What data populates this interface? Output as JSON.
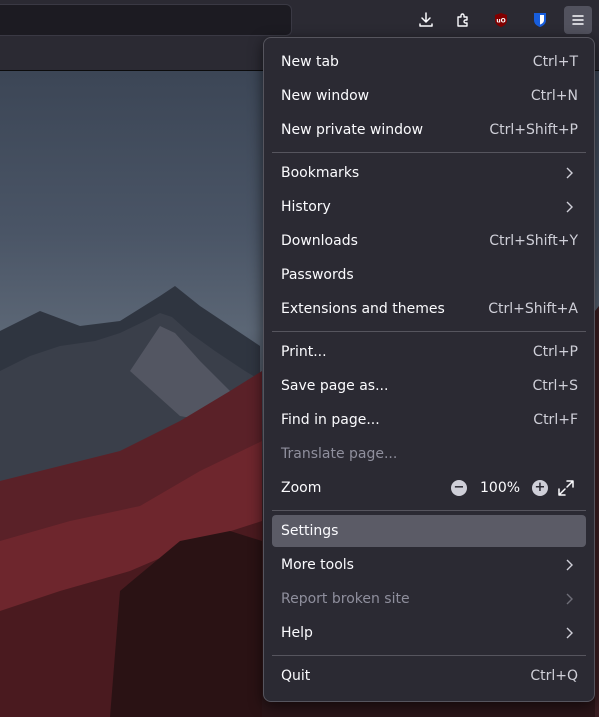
{
  "toolbar": {
    "icons": [
      "downloads-icon",
      "extensions-icon",
      "ublock-origin-icon",
      "bitwarden-icon",
      "hamburger-menu-icon"
    ]
  },
  "menu": {
    "new_tab": {
      "label": "New tab",
      "shortcut": "Ctrl+T"
    },
    "new_window": {
      "label": "New window",
      "shortcut": "Ctrl+N"
    },
    "new_private_window": {
      "label": "New private window",
      "shortcut": "Ctrl+Shift+P"
    },
    "bookmarks": {
      "label": "Bookmarks"
    },
    "history": {
      "label": "History"
    },
    "downloads": {
      "label": "Downloads",
      "shortcut": "Ctrl+Shift+Y"
    },
    "passwords": {
      "label": "Passwords"
    },
    "extensions": {
      "label": "Extensions and themes",
      "shortcut": "Ctrl+Shift+A"
    },
    "print": {
      "label": "Print...",
      "shortcut": "Ctrl+P"
    },
    "save_page": {
      "label": "Save page as...",
      "shortcut": "Ctrl+S"
    },
    "find_in_page": {
      "label": "Find in page...",
      "shortcut": "Ctrl+F"
    },
    "translate_page": {
      "label": "Translate page...",
      "disabled": true
    },
    "zoom": {
      "label": "Zoom",
      "value": "100%",
      "minus": "−",
      "plus": "+"
    },
    "settings": {
      "label": "Settings",
      "hovered": true
    },
    "more_tools": {
      "label": "More tools"
    },
    "report_broken_site": {
      "label": "Report broken site",
      "disabled": true
    },
    "help": {
      "label": "Help"
    },
    "quit": {
      "label": "Quit",
      "shortcut": "Ctrl+Q"
    }
  },
  "colors": {
    "menu_bg": "#2b2a33",
    "hover_bg": "#5b5b66",
    "text": "#fbfbfe",
    "disabled_text": "#8f8f9d",
    "ublock_red": "#800000",
    "bitwarden_blue": "#175ddc"
  }
}
